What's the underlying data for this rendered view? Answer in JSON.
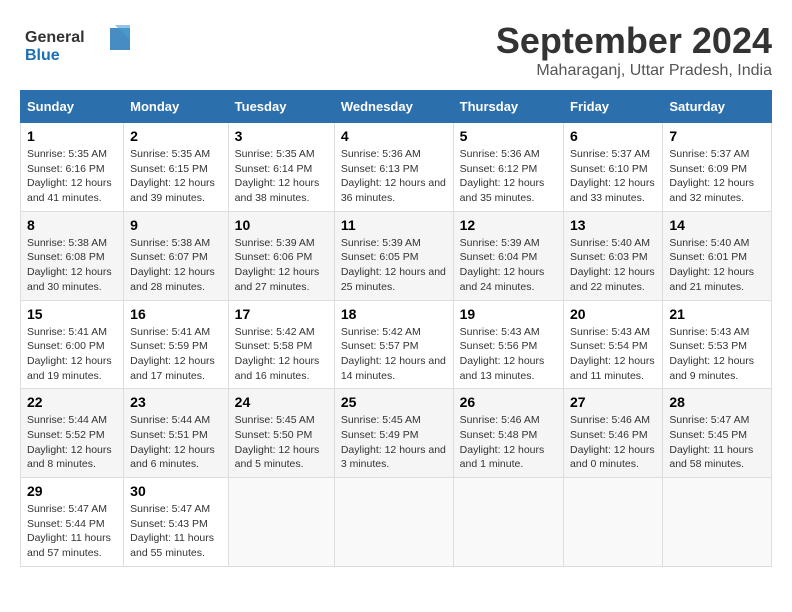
{
  "header": {
    "logo_line1": "General",
    "logo_line2": "Blue",
    "month_title": "September 2024",
    "subtitle": "Maharaganj, Uttar Pradesh, India"
  },
  "weekdays": [
    "Sunday",
    "Monday",
    "Tuesday",
    "Wednesday",
    "Thursday",
    "Friday",
    "Saturday"
  ],
  "weeks": [
    [
      {
        "day": "1",
        "sunrise": "Sunrise: 5:35 AM",
        "sunset": "Sunset: 6:16 PM",
        "daylight": "Daylight: 12 hours and 41 minutes."
      },
      {
        "day": "2",
        "sunrise": "Sunrise: 5:35 AM",
        "sunset": "Sunset: 6:15 PM",
        "daylight": "Daylight: 12 hours and 39 minutes."
      },
      {
        "day": "3",
        "sunrise": "Sunrise: 5:35 AM",
        "sunset": "Sunset: 6:14 PM",
        "daylight": "Daylight: 12 hours and 38 minutes."
      },
      {
        "day": "4",
        "sunrise": "Sunrise: 5:36 AM",
        "sunset": "Sunset: 6:13 PM",
        "daylight": "Daylight: 12 hours and 36 minutes."
      },
      {
        "day": "5",
        "sunrise": "Sunrise: 5:36 AM",
        "sunset": "Sunset: 6:12 PM",
        "daylight": "Daylight: 12 hours and 35 minutes."
      },
      {
        "day": "6",
        "sunrise": "Sunrise: 5:37 AM",
        "sunset": "Sunset: 6:10 PM",
        "daylight": "Daylight: 12 hours and 33 minutes."
      },
      {
        "day": "7",
        "sunrise": "Sunrise: 5:37 AM",
        "sunset": "Sunset: 6:09 PM",
        "daylight": "Daylight: 12 hours and 32 minutes."
      }
    ],
    [
      {
        "day": "8",
        "sunrise": "Sunrise: 5:38 AM",
        "sunset": "Sunset: 6:08 PM",
        "daylight": "Daylight: 12 hours and 30 minutes."
      },
      {
        "day": "9",
        "sunrise": "Sunrise: 5:38 AM",
        "sunset": "Sunset: 6:07 PM",
        "daylight": "Daylight: 12 hours and 28 minutes."
      },
      {
        "day": "10",
        "sunrise": "Sunrise: 5:39 AM",
        "sunset": "Sunset: 6:06 PM",
        "daylight": "Daylight: 12 hours and 27 minutes."
      },
      {
        "day": "11",
        "sunrise": "Sunrise: 5:39 AM",
        "sunset": "Sunset: 6:05 PM",
        "daylight": "Daylight: 12 hours and 25 minutes."
      },
      {
        "day": "12",
        "sunrise": "Sunrise: 5:39 AM",
        "sunset": "Sunset: 6:04 PM",
        "daylight": "Daylight: 12 hours and 24 minutes."
      },
      {
        "day": "13",
        "sunrise": "Sunrise: 5:40 AM",
        "sunset": "Sunset: 6:03 PM",
        "daylight": "Daylight: 12 hours and 22 minutes."
      },
      {
        "day": "14",
        "sunrise": "Sunrise: 5:40 AM",
        "sunset": "Sunset: 6:01 PM",
        "daylight": "Daylight: 12 hours and 21 minutes."
      }
    ],
    [
      {
        "day": "15",
        "sunrise": "Sunrise: 5:41 AM",
        "sunset": "Sunset: 6:00 PM",
        "daylight": "Daylight: 12 hours and 19 minutes."
      },
      {
        "day": "16",
        "sunrise": "Sunrise: 5:41 AM",
        "sunset": "Sunset: 5:59 PM",
        "daylight": "Daylight: 12 hours and 17 minutes."
      },
      {
        "day": "17",
        "sunrise": "Sunrise: 5:42 AM",
        "sunset": "Sunset: 5:58 PM",
        "daylight": "Daylight: 12 hours and 16 minutes."
      },
      {
        "day": "18",
        "sunrise": "Sunrise: 5:42 AM",
        "sunset": "Sunset: 5:57 PM",
        "daylight": "Daylight: 12 hours and 14 minutes."
      },
      {
        "day": "19",
        "sunrise": "Sunrise: 5:43 AM",
        "sunset": "Sunset: 5:56 PM",
        "daylight": "Daylight: 12 hours and 13 minutes."
      },
      {
        "day": "20",
        "sunrise": "Sunrise: 5:43 AM",
        "sunset": "Sunset: 5:54 PM",
        "daylight": "Daylight: 12 hours and 11 minutes."
      },
      {
        "day": "21",
        "sunrise": "Sunrise: 5:43 AM",
        "sunset": "Sunset: 5:53 PM",
        "daylight": "Daylight: 12 hours and 9 minutes."
      }
    ],
    [
      {
        "day": "22",
        "sunrise": "Sunrise: 5:44 AM",
        "sunset": "Sunset: 5:52 PM",
        "daylight": "Daylight: 12 hours and 8 minutes."
      },
      {
        "day": "23",
        "sunrise": "Sunrise: 5:44 AM",
        "sunset": "Sunset: 5:51 PM",
        "daylight": "Daylight: 12 hours and 6 minutes."
      },
      {
        "day": "24",
        "sunrise": "Sunrise: 5:45 AM",
        "sunset": "Sunset: 5:50 PM",
        "daylight": "Daylight: 12 hours and 5 minutes."
      },
      {
        "day": "25",
        "sunrise": "Sunrise: 5:45 AM",
        "sunset": "Sunset: 5:49 PM",
        "daylight": "Daylight: 12 hours and 3 minutes."
      },
      {
        "day": "26",
        "sunrise": "Sunrise: 5:46 AM",
        "sunset": "Sunset: 5:48 PM",
        "daylight": "Daylight: 12 hours and 1 minute."
      },
      {
        "day": "27",
        "sunrise": "Sunrise: 5:46 AM",
        "sunset": "Sunset: 5:46 PM",
        "daylight": "Daylight: 12 hours and 0 minutes."
      },
      {
        "day": "28",
        "sunrise": "Sunrise: 5:47 AM",
        "sunset": "Sunset: 5:45 PM",
        "daylight": "Daylight: 11 hours and 58 minutes."
      }
    ],
    [
      {
        "day": "29",
        "sunrise": "Sunrise: 5:47 AM",
        "sunset": "Sunset: 5:44 PM",
        "daylight": "Daylight: 11 hours and 57 minutes."
      },
      {
        "day": "30",
        "sunrise": "Sunrise: 5:47 AM",
        "sunset": "Sunset: 5:43 PM",
        "daylight": "Daylight: 11 hours and 55 minutes."
      },
      null,
      null,
      null,
      null,
      null
    ]
  ]
}
